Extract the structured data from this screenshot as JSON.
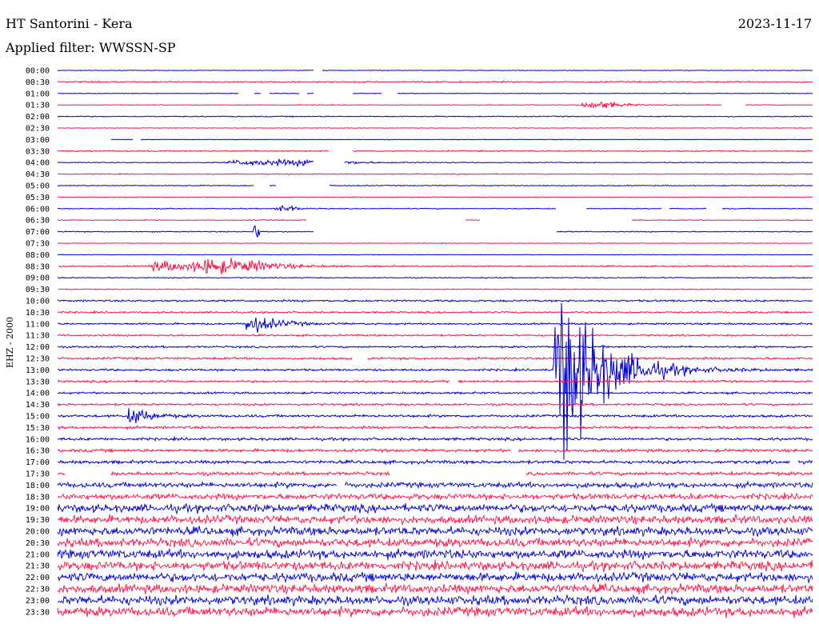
{
  "header": {
    "station": "HT Santorini - Kera",
    "date": "2023-11-17",
    "filter": "Applied filter: WWSSN-SP",
    "channel": "EHZ - 2000"
  },
  "colors": {
    "even_rows": "#0000cc",
    "odd_rows": "#ff1144",
    "background": "#ffffff"
  },
  "chart_data": {
    "type": "seismogram",
    "time_axis_labels": [
      "00:00",
      "00:30",
      "01:00",
      "01:30",
      "02:00",
      "02:30",
      "03:00",
      "03:30",
      "04:00",
      "04:30",
      "05:00",
      "05:30",
      "06:00",
      "06:30",
      "07:00",
      "07:30",
      "08:00",
      "08:30",
      "09:00",
      "09:30",
      "10:00",
      "10:30",
      "11:00",
      "11:30",
      "12:00",
      "12:30",
      "13:00",
      "13:30",
      "14:00",
      "14:30",
      "15:00",
      "15:30",
      "16:00",
      "16:30",
      "17:00",
      "17:30",
      "18:00",
      "18:30",
      "19:00",
      "19:30",
      "20:00",
      "20:30",
      "21:00",
      "21:30",
      "22:00",
      "22:30",
      "23:00",
      "23:30"
    ],
    "row_duration_minutes": 30,
    "noise_level": [
      0.3,
      0.8,
      0.4,
      0.4,
      0.6,
      0.3,
      0.3,
      0.7,
      0.5,
      0.5,
      0.5,
      0.4,
      0.5,
      0.5,
      0.6,
      0.3,
      0.3,
      0.8,
      0.6,
      0.5,
      1.1,
      1.0,
      1.0,
      1.0,
      1.1,
      1.2,
      1.2,
      1.2,
      1.1,
      1.2,
      1.4,
      1.5,
      1.5,
      1.6,
      1.8,
      1.8,
      3.0,
      3.3,
      4.5,
      4.5,
      4.8,
      4.8,
      5.0,
      5.0,
      5.0,
      5.0,
      5.2,
      5.2
    ],
    "gaps": [
      {
        "row": 0,
        "from": 0.34,
        "to": 0.35
      },
      {
        "row": 2,
        "from": 0.24,
        "to": 0.26
      },
      {
        "row": 2,
        "from": 0.27,
        "to": 0.28
      },
      {
        "row": 2,
        "from": 0.32,
        "to": 0.33
      },
      {
        "row": 2,
        "from": 0.34,
        "to": 0.39
      },
      {
        "row": 2,
        "from": 0.43,
        "to": 0.45
      },
      {
        "row": 3,
        "from": 0.88,
        "to": 0.91
      },
      {
        "row": 6,
        "from": 0.0,
        "to": 0.07
      },
      {
        "row": 6,
        "from": 0.1,
        "to": 0.11
      },
      {
        "row": 7,
        "from": 0.36,
        "to": 0.39
      },
      {
        "row": 8,
        "from": 0.34,
        "to": 0.38
      },
      {
        "row": 10,
        "from": 0.26,
        "to": 0.28
      },
      {
        "row": 10,
        "from": 0.29,
        "to": 0.36
      },
      {
        "row": 12,
        "from": 0.66,
        "to": 0.7
      },
      {
        "row": 12,
        "from": 0.8,
        "to": 0.81
      },
      {
        "row": 12,
        "from": 0.86,
        "to": 0.88
      },
      {
        "row": 13,
        "from": 0.33,
        "to": 0.54
      },
      {
        "row": 13,
        "from": 0.56,
        "to": 0.76
      },
      {
        "row": 14,
        "from": 0.34,
        "to": 0.66
      },
      {
        "row": 17,
        "from": 0.0,
        "to": 0.0
      },
      {
        "row": 19,
        "from": 0.0,
        "to": 0.0
      },
      {
        "row": 25,
        "from": 0.39,
        "to": 0.41
      },
      {
        "row": 27,
        "from": 0.52,
        "to": 0.53
      },
      {
        "row": 33,
        "from": 0.6,
        "to": 0.61
      },
      {
        "row": 34,
        "from": 0.97,
        "to": 0.98
      },
      {
        "row": 35,
        "from": 0.01,
        "to": 0.07
      },
      {
        "row": 35,
        "from": 0.44,
        "to": 0.62
      },
      {
        "row": 36,
        "from": 0.37,
        "to": 0.38
      }
    ],
    "events": [
      {
        "row": 3,
        "x": 0.7,
        "amp": 4,
        "width": 0.03,
        "decay": 0.02
      },
      {
        "row": 8,
        "x": 0.24,
        "amp": 3,
        "width": 0.08,
        "decay": 0.05
      },
      {
        "row": 8,
        "x": 0.33,
        "amp": 3,
        "width": 0.03,
        "decay": 0.02
      },
      {
        "row": 12,
        "x": 0.29,
        "amp": 3,
        "width": 0.02,
        "decay": 0.01
      },
      {
        "row": 14,
        "x": 0.26,
        "amp": 16,
        "width": 0.003,
        "decay": 0.003
      },
      {
        "row": 17,
        "x": 0.13,
        "amp": 5,
        "width": 0.06,
        "decay": 0.03
      },
      {
        "row": 17,
        "x": 0.2,
        "amp": 6,
        "width": 0.06,
        "decay": 0.04
      },
      {
        "row": 22,
        "x": 0.25,
        "amp": 9,
        "width": 0.015,
        "decay": 0.03
      },
      {
        "row": 26,
        "x": 0.66,
        "amp": 95,
        "width": 0.014,
        "decay": 0.05
      },
      {
        "row": 30,
        "x": 0.095,
        "amp": 9,
        "width": 0.01,
        "decay": 0.02
      }
    ]
  }
}
